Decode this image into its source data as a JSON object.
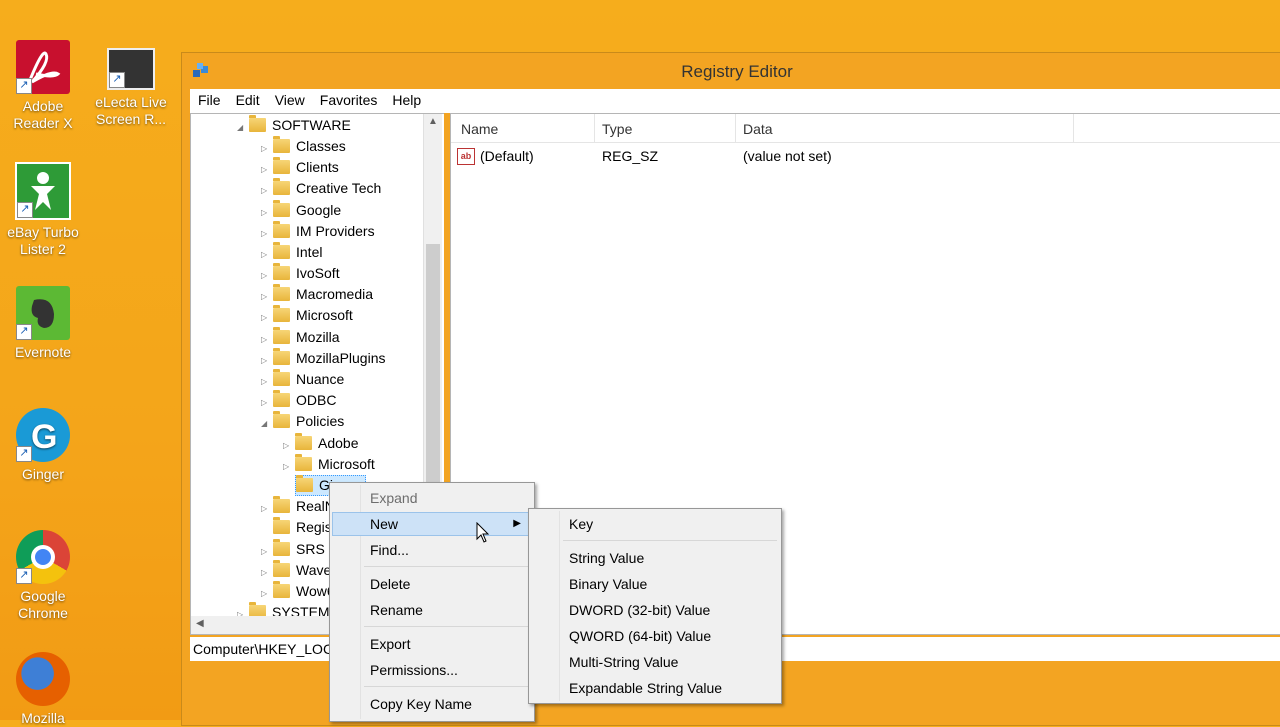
{
  "desktop": {
    "icons": [
      {
        "label": "Adobe Reader X",
        "icon": "adobe-reader-icon"
      },
      {
        "label": "eLecta Live Screen R...",
        "icon": "film-strip-icon"
      },
      {
        "label": "eBay Turbo Lister 2",
        "icon": "ebay-turbo-lister-icon"
      },
      {
        "label": "Evernote",
        "icon": "evernote-elephant-icon"
      },
      {
        "label": "Ginger",
        "icon": "ginger-g-icon"
      },
      {
        "label": "Google Chrome",
        "icon": "chrome-icon"
      },
      {
        "label": "Mozilla",
        "icon": "firefox-icon"
      }
    ]
  },
  "window": {
    "title": "Registry Editor",
    "app_icon": "registry-cubes-icon",
    "menu": [
      "File",
      "Edit",
      "View",
      "Favorites",
      "Help"
    ]
  },
  "tree": {
    "root": "SOFTWARE",
    "items": [
      "Classes",
      "Clients",
      "Creative Tech",
      "Google",
      "IM Providers",
      "Intel",
      "IvoSoft",
      "Macromedia",
      "Microsoft",
      "Mozilla",
      "MozillaPlugins",
      "Nuance",
      "ODBC",
      "Policies"
    ],
    "policies_children": [
      "Adobe",
      "Microsoft",
      "Ginger"
    ],
    "after": [
      "RealNetworks",
      "RegisteredApplications",
      "SRS Labs",
      "Wavelib",
      "Wow6432Node"
    ],
    "next_root": "SYSTEM"
  },
  "list": {
    "columns": [
      "Name",
      "Type",
      "Data"
    ],
    "rows": [
      {
        "name": "(Default)",
        "type": "REG_SZ",
        "data": "(value not set)"
      }
    ]
  },
  "status": "Computer\\HKEY_LOCAL_MACHINE\\SOFTWARE\\Policies\\Ginger",
  "context_menu": {
    "items": [
      "Expand",
      "New",
      "Find...",
      "Delete",
      "Rename",
      "Export",
      "Permissions...",
      "Copy Key Name"
    ]
  },
  "new_submenu": {
    "items": [
      "Key",
      "String Value",
      "Binary Value",
      "DWORD (32-bit) Value",
      "QWORD (64-bit) Value",
      "Multi-String Value",
      "Expandable String Value"
    ]
  },
  "colors": {
    "desktop": "#f4a51a",
    "highlight": "#cde2f7"
  }
}
